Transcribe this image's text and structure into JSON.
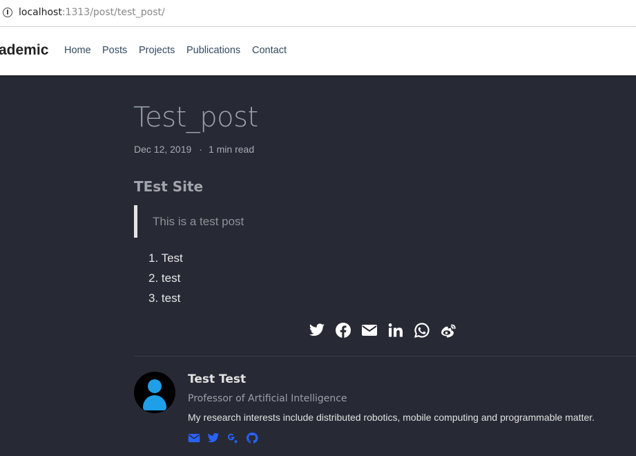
{
  "browser": {
    "url_host": "localhost",
    "url_rest": ":1313/post/test_post/"
  },
  "navbar": {
    "brand": "ademic",
    "items": [
      "Home",
      "Posts",
      "Projects",
      "Publications",
      "Contact"
    ]
  },
  "post": {
    "title": "Test_post",
    "date": "Dec 12, 2019",
    "meta_separator": "·",
    "reading_time": "1 min read",
    "heading": "TEst Site",
    "blockquote": "This is a test post",
    "list": [
      "Test",
      "test",
      "test"
    ]
  },
  "share": {
    "icons": [
      "twitter-icon",
      "facebook-icon",
      "envelope-icon",
      "linkedin-icon",
      "whatsapp-icon",
      "weibo-icon"
    ],
    "color": "#ffffff"
  },
  "author": {
    "name": "Test Test",
    "role": "Professor of Artificial Intelligence",
    "bio": "My research interests include distributed robotics, mobile computing and programmable matter.",
    "links": [
      "envelope-icon",
      "twitter-icon",
      "google-plus-icon",
      "github-icon"
    ],
    "link_color": "#2962ff",
    "avatar_color": "#1e9fe8"
  },
  "colors": {
    "background": "#272a35",
    "navbar": "#ffffff"
  }
}
